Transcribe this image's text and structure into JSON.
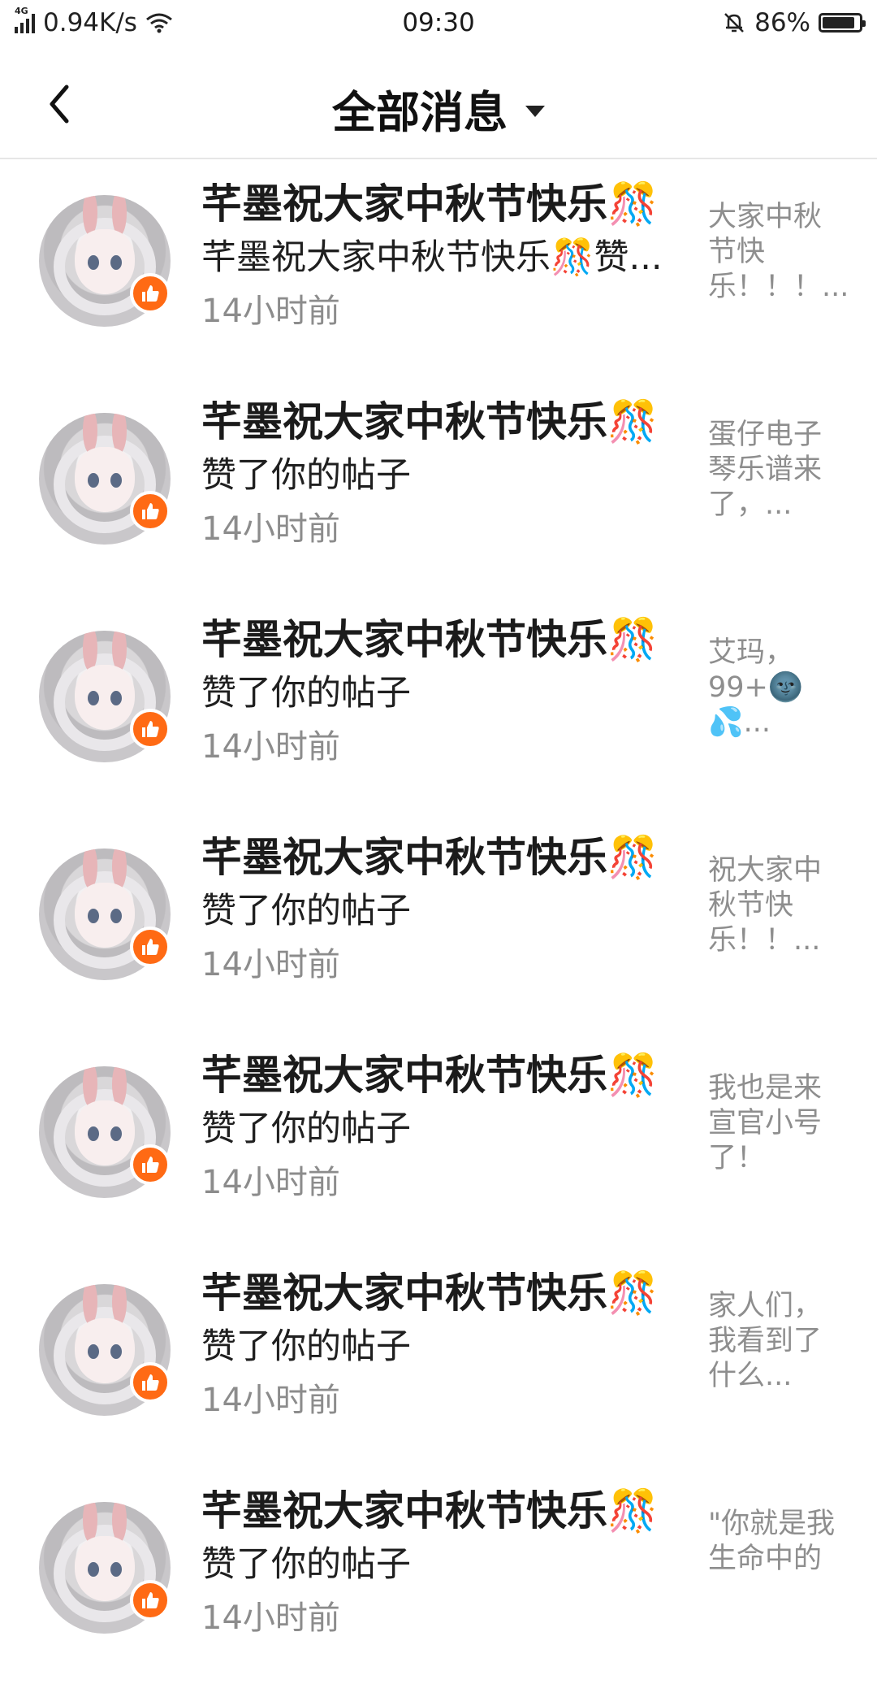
{
  "status_bar": {
    "network": "4G",
    "speed": "0.94K/s",
    "time": "09:30",
    "battery": "86%",
    "battery_level": 0.86
  },
  "header": {
    "title": "全部消息",
    "back_icon": "chevron-left-icon",
    "dropdown_icon": "caret-down-icon"
  },
  "messages": [
    {
      "title": "芊墨祝大家中秋节快乐🎊",
      "desc": "芊墨祝大家中秋节快乐🎊赞...",
      "time": "14小时前",
      "preview": "大家中秋节快乐！！！..."
    },
    {
      "title": "芊墨祝大家中秋节快乐🎊",
      "desc": "赞了你的帖子",
      "time": "14小时前",
      "preview": "蛋仔电子琴乐谱来了，..."
    },
    {
      "title": "芊墨祝大家中秋节快乐🎊",
      "desc": "赞了你的帖子",
      "time": "14小时前",
      "preview": "艾玛，99+🌚💦..."
    },
    {
      "title": "芊墨祝大家中秋节快乐🎊",
      "desc": "赞了你的帖子",
      "time": "14小时前",
      "preview": "祝大家中秋节快乐！！..."
    },
    {
      "title": "芊墨祝大家中秋节快乐🎊",
      "desc": "赞了你的帖子",
      "time": "14小时前",
      "preview": "我也是来宣官小号了！"
    },
    {
      "title": "芊墨祝大家中秋节快乐🎊",
      "desc": "赞了你的帖子",
      "time": "14小时前",
      "preview": "家人们，我看到了什么..."
    },
    {
      "title": "芊墨祝大家中秋节快乐🎊",
      "desc": "赞了你的帖子",
      "time": "14小时前",
      "preview": "\"你就是我生命中的"
    }
  ],
  "like_badge_icon": "thumbs-up-icon",
  "colors": {
    "badge": "#ff6a14",
    "secondary_text": "#8c8c8c"
  }
}
